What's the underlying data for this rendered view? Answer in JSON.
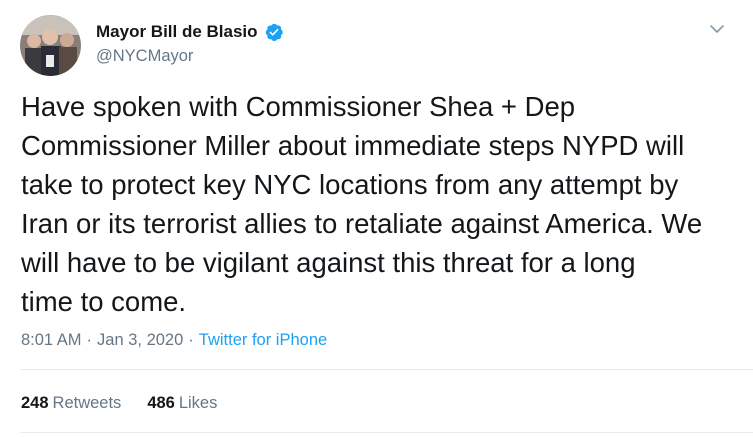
{
  "author": {
    "name": "Mayor Bill de Blasio",
    "handle": "@NYCMayor",
    "verified": true,
    "avatar_icon": "avatar-photo"
  },
  "tweet": {
    "text": "Have spoken with Commissioner Shea + Dep\nCommissioner Miller about immediate steps NYPD will\ntake to protect key NYC locations from any attempt by\nIran or its terrorist allies to retaliate against America. We\nwill have to be vigilant against this threat for a long\ntime to come."
  },
  "meta": {
    "time": "8:01 AM",
    "separator": "·",
    "date": "Jan 3, 2020",
    "source": "Twitter for iPhone"
  },
  "stats": {
    "retweets_count": "248",
    "retweets_label": "Retweets",
    "likes_count": "486",
    "likes_label": "Likes"
  },
  "colors": {
    "verified": "#1da1f2",
    "link": "#1da1f2",
    "secondary_text": "#657786"
  }
}
